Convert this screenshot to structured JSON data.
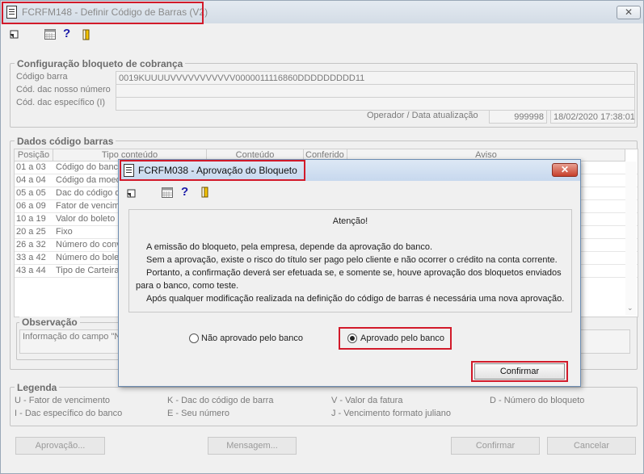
{
  "main_window": {
    "title": "FCRFM148 - Definir Código de Barras (V2)",
    "close_label": "✕",
    "toolbar": {
      "exit_icon": "exit-icon",
      "calendar_icon": "calendar-icon",
      "help_icon": "?",
      "door_icon": "door-icon"
    }
  },
  "config": {
    "group_title": "Configuração bloqueto de cobrança",
    "codigo_barra_label": "Código barra",
    "codigo_barra_value": "0019KUUUUVVVVVVVVVVV0000011116860DDDDDDDDD11",
    "dac_nosso_numero_label": "Cód. dac nosso número",
    "dac_especifico_label": "Cód. dac específico (I)",
    "operador_label": "Operador / Data atualização",
    "operador_value": "999998",
    "data_value": "18/02/2020 17:38:01"
  },
  "dados": {
    "group_title": "Dados código barras",
    "columns": [
      "Posição",
      "Tipo conteúdo",
      "Conteúdo",
      "Conferido",
      "Aviso"
    ],
    "rows": [
      {
        "posicao": "01 a 03",
        "tipo": "Código do banco"
      },
      {
        "posicao": "04 a 04",
        "tipo": "Código da moeda"
      },
      {
        "posicao": "05 a 05",
        "tipo": "Dac do código de"
      },
      {
        "posicao": "06 a 09",
        "tipo": "Fator de vencimento"
      },
      {
        "posicao": "10 a 19",
        "tipo": "Valor do boleto"
      },
      {
        "posicao": "20 a 25",
        "tipo": "Fixo"
      },
      {
        "posicao": "26 a 32",
        "tipo": "Número do conv"
      },
      {
        "posicao": "33 a 42",
        "tipo": "Número do bolet"
      },
      {
        "posicao": "43 a 44",
        "tipo": "Tipo de Carteira"
      }
    ]
  },
  "observacao": {
    "group_title": "Observação",
    "text": "Informação do campo \"No"
  },
  "legenda": {
    "group_title": "Legenda",
    "items": [
      "U - Fator de vencimento",
      "K - Dac do código de barra",
      "V - Valor da fatura",
      "D - Número do bloqueto",
      "I - Dac específico do banco",
      "E - Seu número",
      "J - Vencimento formato juliano"
    ]
  },
  "bottom_buttons": {
    "aprovacao": "Aprovação...",
    "mensagem": "Mensagem...",
    "confirmar": "Confirmar",
    "cancelar": "Cancelar"
  },
  "dialog": {
    "title": "FCRFM038 - Aprovação do Bloqueto",
    "close_label": "✕",
    "heading": "Atenção!",
    "lines": [
      "A emissão do bloqueto, pela empresa, depende da aprovação do banco.",
      "Sem a aprovação, existe o risco do título ser pago pelo cliente e não ocorrer o crédito na conta corrente.",
      "Portanto, a confirmação deverá ser efetuada se, e somente se, houve aprovação dos bloquetos enviados",
      "para o banco, como teste.",
      "Após qualquer modificação realizada na definição do código de barras é necessária uma nova aprovação."
    ],
    "radio_not_approved": "Não aprovado pelo banco",
    "radio_approved": "Aprovado pelo banco",
    "selected": "Aprovado pelo banco",
    "confirm_label": "Confirmar"
  },
  "colors": {
    "highlight_red": "#d21a2a",
    "dialog_border": "#6d8db2"
  }
}
